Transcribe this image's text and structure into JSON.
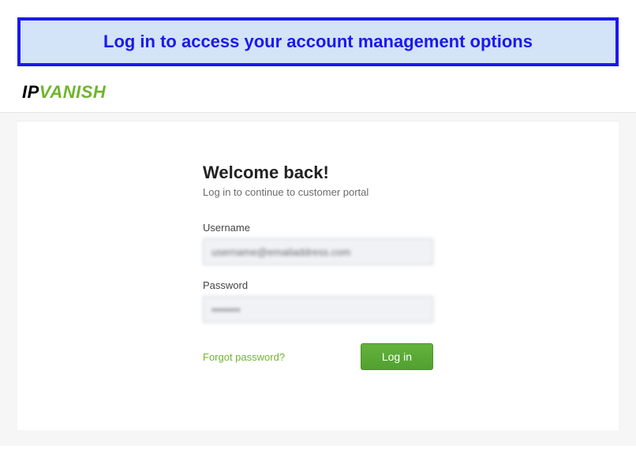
{
  "banner": {
    "text": "Log in to access your account management options"
  },
  "logo": {
    "part1": "IP",
    "part2": "VANISH"
  },
  "login": {
    "title": "Welcome back!",
    "subtitle": "Log in to continue to customer portal",
    "username_label": "Username",
    "username_value": "username@emailaddress.com",
    "password_label": "Password",
    "password_value": "********",
    "forgot_label": "Forgot password?",
    "submit_label": "Log in"
  },
  "colors": {
    "accent_green": "#70b52b",
    "banner_blue": "#1919ef",
    "banner_bg": "#d3e3f8"
  }
}
